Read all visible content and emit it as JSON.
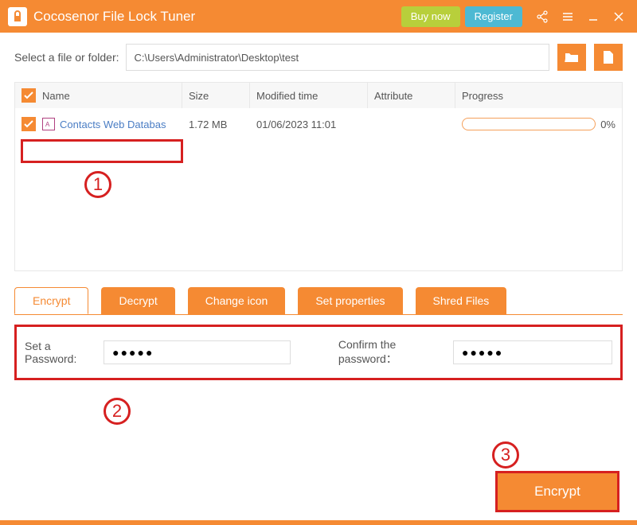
{
  "titlebar": {
    "app_name": "Cocosenor File Lock Tuner",
    "buy_label": "Buy now",
    "register_label": "Register"
  },
  "path": {
    "label": "Select a file or folder:",
    "value": "C:\\Users\\Administrator\\Desktop\\test"
  },
  "table": {
    "headers": {
      "name": "Name",
      "size": "Size",
      "modified": "Modified time",
      "attribute": "Attribute",
      "progress": "Progress"
    },
    "rows": [
      {
        "name": "Contacts Web Databas",
        "size": "1.72 MB",
        "modified": "01/06/2023 11:01",
        "attribute": "",
        "progress": "0%"
      }
    ]
  },
  "tabs": {
    "encrypt": "Encrypt",
    "decrypt": "Decrypt",
    "change_icon": "Change icon",
    "set_properties": "Set properties",
    "shred": "Shred Files"
  },
  "password": {
    "set_label": "Set a Password:",
    "set_value": "●●●●●",
    "confirm_label": "Confirm the password：",
    "confirm_value": "●●●●●"
  },
  "action": {
    "encrypt_label": "Encrypt"
  },
  "annotations": {
    "one": "1",
    "two": "2",
    "three": "3"
  }
}
